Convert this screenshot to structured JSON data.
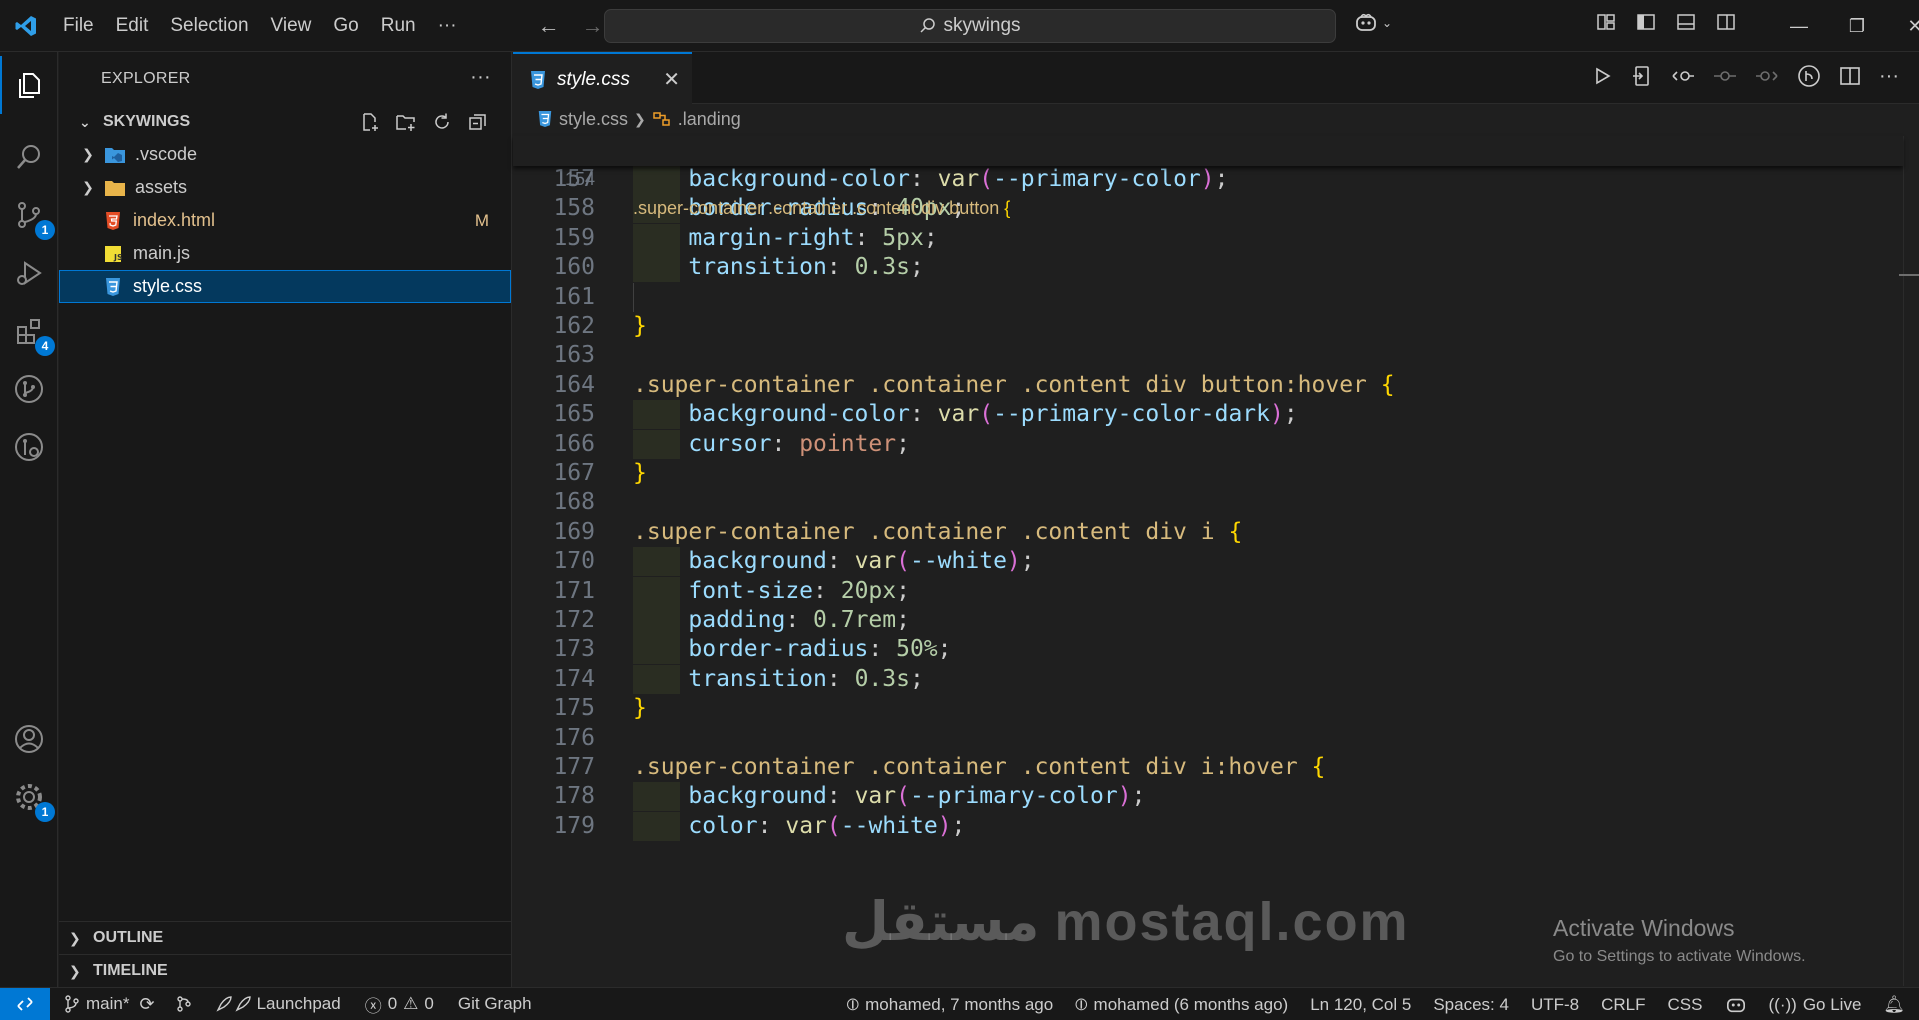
{
  "titlebar": {
    "menu": [
      "File",
      "Edit",
      "Selection",
      "View",
      "Go",
      "Run",
      "···"
    ],
    "search": "skywings"
  },
  "activity": {
    "badges": {
      "scm": "1",
      "extensions": "4",
      "settings": "1"
    }
  },
  "sidebar": {
    "title": "EXPLORER",
    "more": "···",
    "root": "SKYWINGS",
    "tree": [
      {
        "name": ".vscode",
        "type": "folder"
      },
      {
        "name": "assets",
        "type": "folder"
      },
      {
        "name": "index.html",
        "type": "html",
        "status": "M"
      },
      {
        "name": "main.js",
        "type": "js"
      },
      {
        "name": "style.css",
        "type": "css",
        "selected": true
      }
    ],
    "outline": "OUTLINE",
    "timeline": "TIMELINE"
  },
  "editor": {
    "tab": "style.css",
    "breadcrumb": {
      "file": "style.css",
      "symbol": ".landing"
    },
    "sticky": {
      "ln": "154",
      "sel": ".super-container .container .content div button",
      "open": "{"
    },
    "lines": [
      {
        "ln": "157",
        "indent": true,
        "prop": "background-color",
        "fn": "var",
        "var": "--primary-color"
      },
      {
        "ln": "158",
        "indent": true,
        "prop": "border-radius",
        "num": "40px"
      },
      {
        "ln": "159",
        "indent": true,
        "prop": "margin-right",
        "num": "5px"
      },
      {
        "ln": "160",
        "indent": true,
        "prop": "transition",
        "num": "0.3s"
      },
      {
        "ln": "161",
        "guide": true
      },
      {
        "ln": "162",
        "close": "}"
      },
      {
        "ln": "163"
      },
      {
        "ln": "164",
        "sel": ".super-container .container .content div button:hover",
        "open": "{"
      },
      {
        "ln": "165",
        "indent": true,
        "prop": "background-color",
        "fn": "var",
        "var": "--primary-color-dark"
      },
      {
        "ln": "166",
        "indent": true,
        "prop": "cursor",
        "kw": "pointer"
      },
      {
        "ln": "167",
        "close": "}"
      },
      {
        "ln": "168"
      },
      {
        "ln": "169",
        "sel": ".super-container .container .content div i",
        "open": "{"
      },
      {
        "ln": "170",
        "indent": true,
        "prop": "background",
        "fn": "var",
        "var": "--white"
      },
      {
        "ln": "171",
        "indent": true,
        "prop": "font-size",
        "num": "20px"
      },
      {
        "ln": "172",
        "indent": true,
        "prop": "padding",
        "num": "0.7rem"
      },
      {
        "ln": "173",
        "indent": true,
        "prop": "border-radius",
        "num": "50%"
      },
      {
        "ln": "174",
        "indent": true,
        "prop": "transition",
        "num": "0.3s"
      },
      {
        "ln": "175",
        "close": "}"
      },
      {
        "ln": "176"
      },
      {
        "ln": "177",
        "sel": ".super-container .container .content div i:hover",
        "open": "{"
      },
      {
        "ln": "178",
        "indent": true,
        "prop": "background",
        "fn": "var",
        "var": "--primary-color"
      },
      {
        "ln": "179",
        "indent": true,
        "prop": "color",
        "fn": "var",
        "var": "--white"
      }
    ]
  },
  "overlay": {
    "activate_title": "Activate Windows",
    "activate_sub": "Go to Settings to activate Windows.",
    "watermark": "مستقل mostaql.com"
  },
  "statusbar": {
    "branch": "main*",
    "launchpad": "Launchpad",
    "errors": "0",
    "warnings": "0",
    "gitgraph": "Git Graph",
    "blame1": "mohamed, 7 months ago",
    "blame2": "mohamed (6 months ago)",
    "cursor": "Ln 120, Col 5",
    "spaces": "Spaces: 4",
    "encoding": "UTF-8",
    "eol": "CRLF",
    "language": "CSS",
    "golive": "Go Live"
  },
  "colors": {
    "accent": "#0078d4",
    "selector": "#d7ba7d",
    "property": "#9cdcfe",
    "number": "#b5cea8",
    "keyword": "#ce9178",
    "bracket1": "#ffd700",
    "bracket2": "#da70d6"
  }
}
